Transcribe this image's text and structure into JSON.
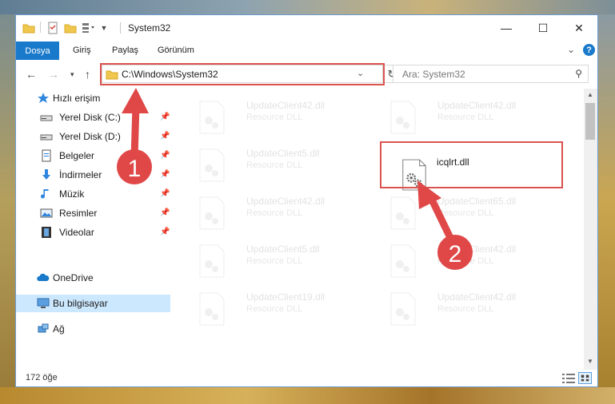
{
  "window": {
    "title": "System32",
    "controls": {
      "minimize": "—",
      "maximize": "☐",
      "close": "✕"
    }
  },
  "ribbon": {
    "tabs": [
      "Dosya",
      "Giriş",
      "Paylaş",
      "Görünüm"
    ]
  },
  "address": {
    "path": "C:\\Windows\\System32",
    "search_placeholder": "Ara: System32"
  },
  "nav_pane": {
    "quick_access": "Hızlı erişim",
    "items": [
      {
        "label": "Yerel Disk (C:)",
        "icon": "drive-icon",
        "pinned": true
      },
      {
        "label": "Yerel Disk (D:)",
        "icon": "drive-icon",
        "pinned": true
      },
      {
        "label": "Belgeler",
        "icon": "documents-icon",
        "pinned": true
      },
      {
        "label": "İndirmeler",
        "icon": "downloads-icon",
        "pinned": true
      },
      {
        "label": "Müzik",
        "icon": "music-icon",
        "pinned": true
      },
      {
        "label": "Resimler",
        "icon": "pictures-icon",
        "pinned": true
      },
      {
        "label": "Videolar",
        "icon": "videos-icon",
        "pinned": true
      }
    ],
    "onedrive": "OneDrive",
    "this_pc": "Bu bilgisayar",
    "network": "Ağ"
  },
  "files": [
    {
      "name": "UpdateClient42.dll",
      "type": "Resource DLL",
      "faded": true
    },
    {
      "name": "UpdateClient42.dll",
      "type": "Resource DLL",
      "faded": true
    },
    {
      "name": "UpdateClient5.dll",
      "type": "Resource DLL",
      "faded": true
    },
    {
      "name": "icqlrt.dll",
      "type": "",
      "faded": false,
      "highlighted": true
    },
    {
      "name": "UpdateClient42.dll",
      "type": "Resource DLL",
      "faded": true
    },
    {
      "name": "UpdateClient65.dll",
      "type": "Resource DLL",
      "faded": true
    },
    {
      "name": "UpdateClient5.dll",
      "type": "Resource DLL",
      "faded": true
    },
    {
      "name": "UpdateClient42.dll",
      "type": "Resource DLL",
      "faded": true
    },
    {
      "name": "UpdateClient19.dll",
      "type": "Resource DLL",
      "faded": true
    },
    {
      "name": "UpdateClient42.dll",
      "type": "Resource DLL",
      "faded": true
    }
  ],
  "status": {
    "item_count": "172 öğe"
  },
  "callouts": {
    "one": "1",
    "two": "2",
    "color": "#d9534f"
  },
  "colors": {
    "accent": "#1979ca",
    "selected": "#cce8ff"
  }
}
